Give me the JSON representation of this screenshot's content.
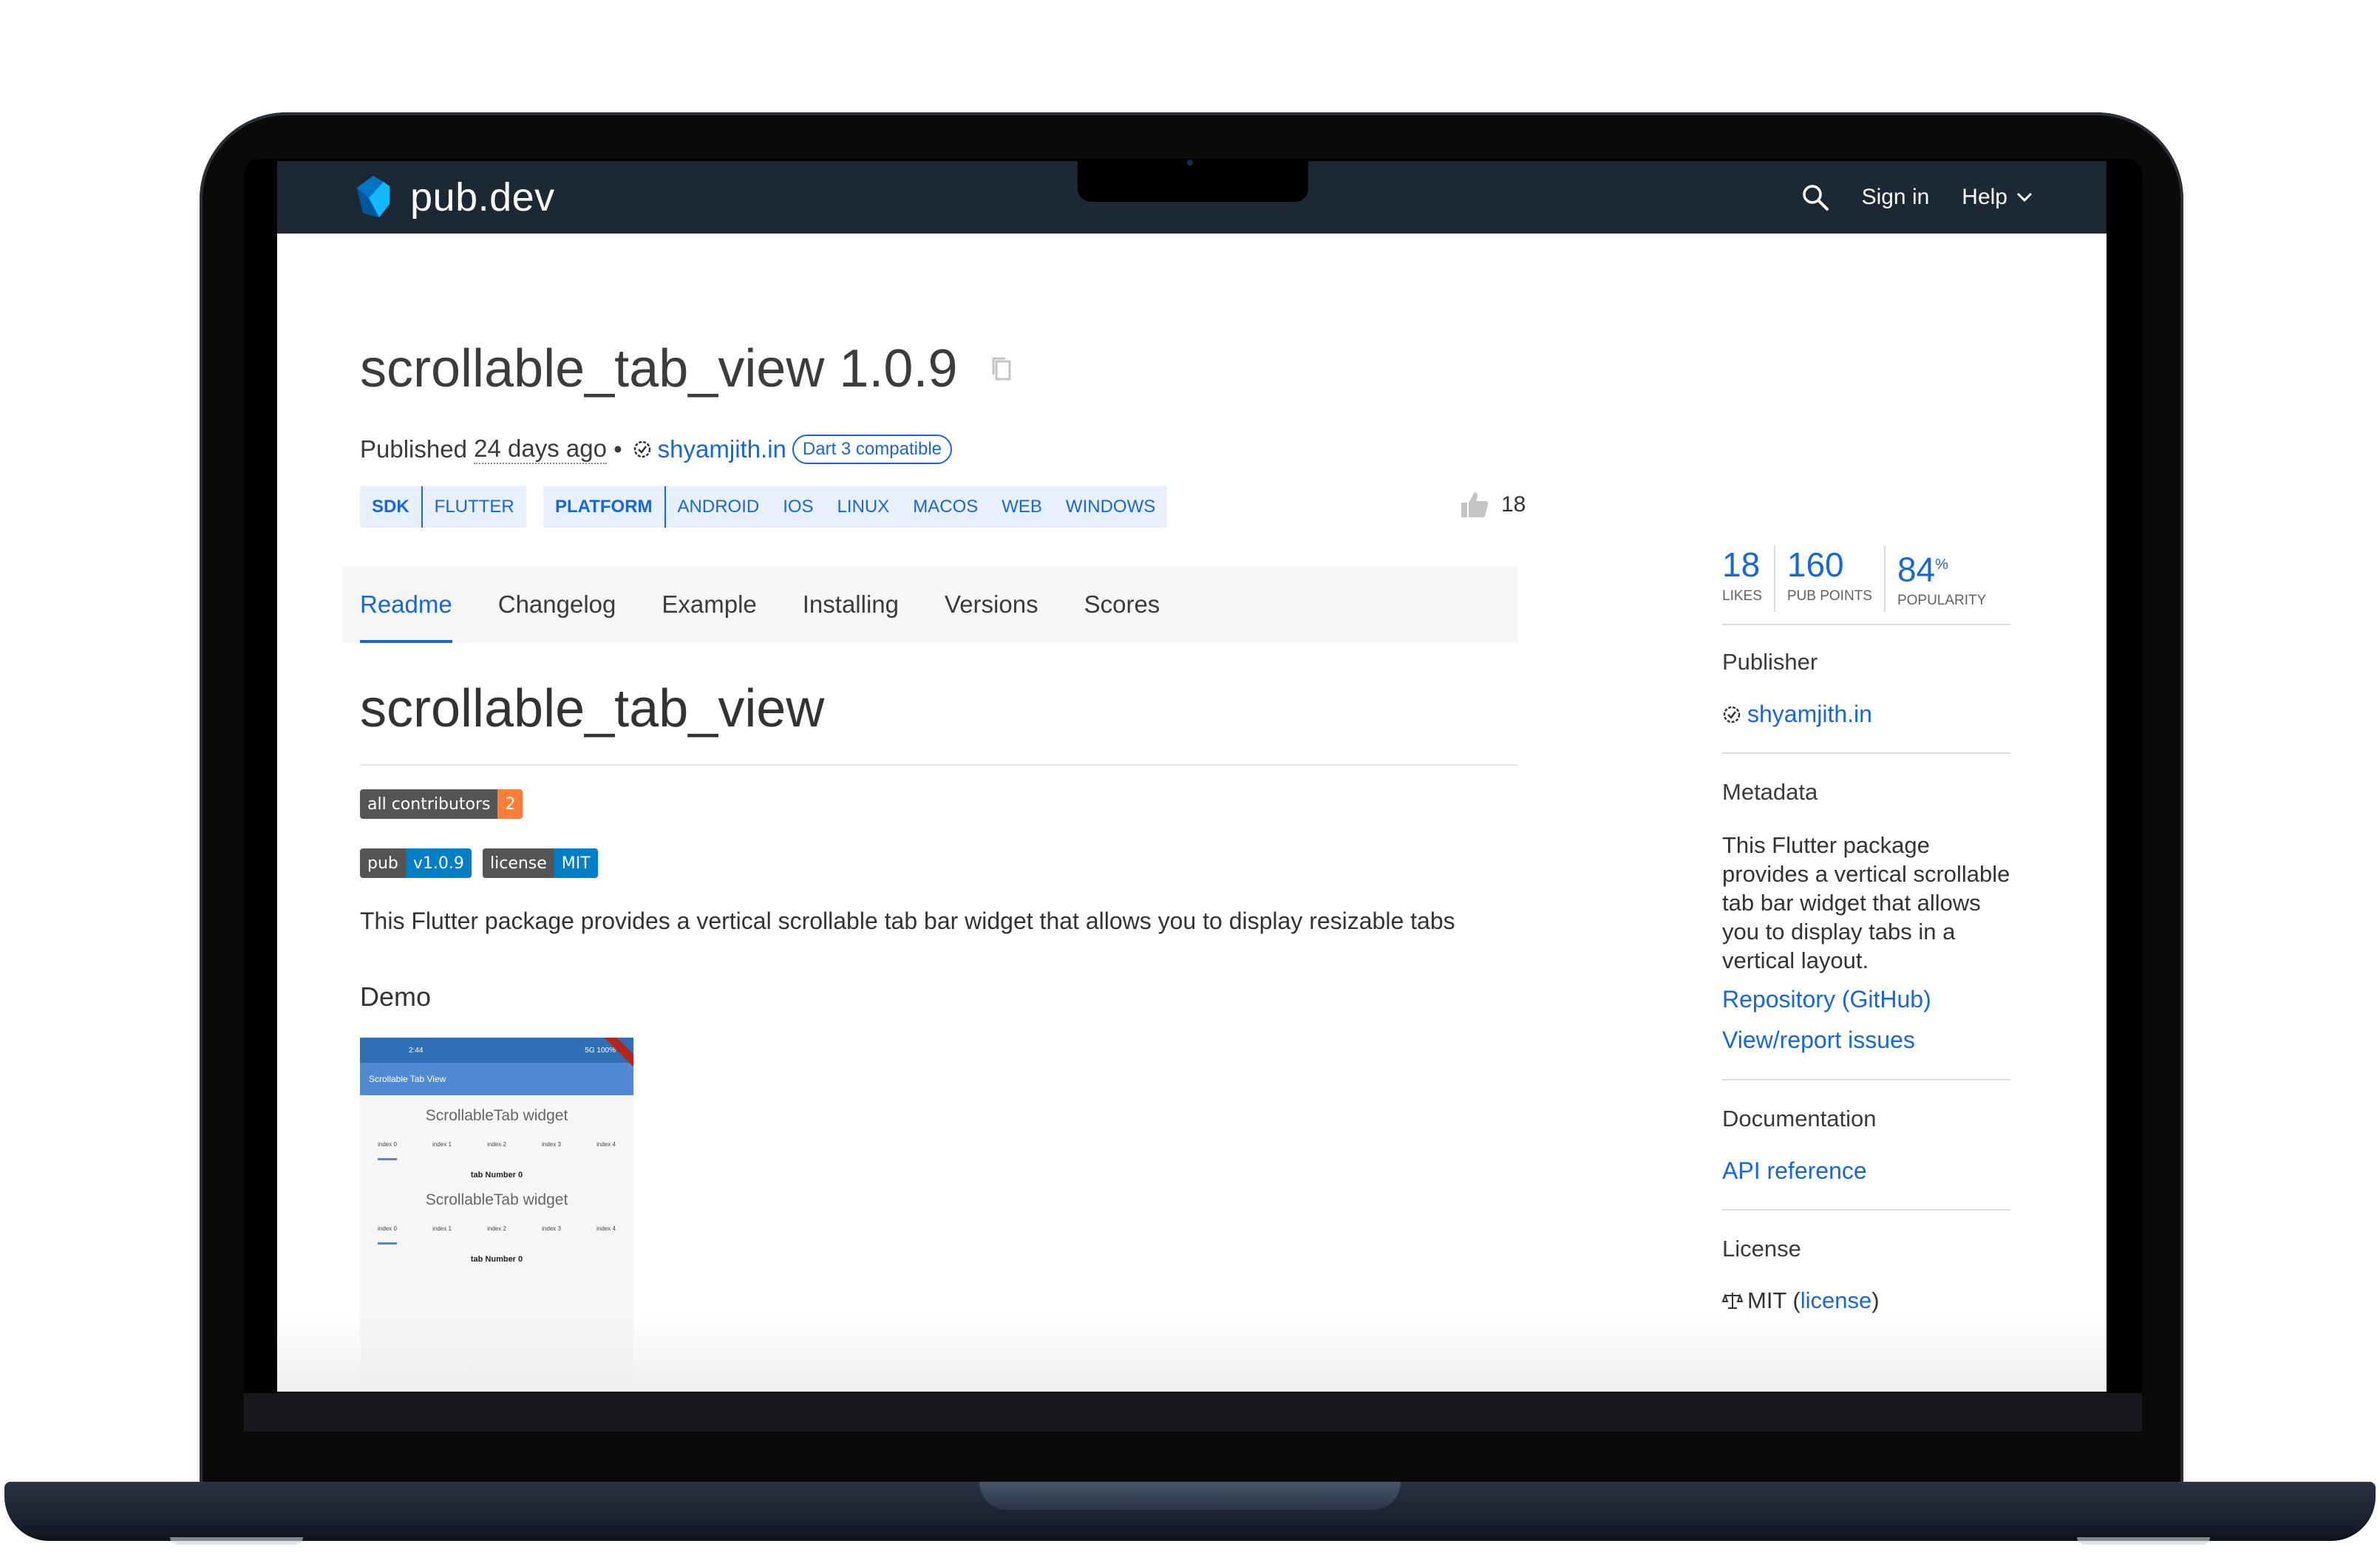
{
  "header": {
    "logo_text": "pub.dev",
    "sign_in": "Sign in",
    "help": "Help"
  },
  "package": {
    "title": "scrollable_tab_view 1.0.9",
    "published_prefix": "Published",
    "published_ago": "24 days ago",
    "separator": "•",
    "publisher": "shyamjith.in",
    "dart3_badge": "Dart 3 compatible",
    "likes_count": "18"
  },
  "tags": {
    "sdk_head": "SDK",
    "sdk": [
      "FLUTTER"
    ],
    "platform_head": "PLATFORM",
    "platforms": [
      "ANDROID",
      "IOS",
      "LINUX",
      "MACOS",
      "WEB",
      "WINDOWS"
    ]
  },
  "tabs": [
    "Readme",
    "Changelog",
    "Example",
    "Installing",
    "Versions",
    "Scores"
  ],
  "readme": {
    "heading": "scrollable_tab_view",
    "shield_contributors_label": "all contributors",
    "shield_contributors_value": "2",
    "shield_pub_label": "pub",
    "shield_pub_value": "v1.0.9",
    "shield_license_label": "license",
    "shield_license_value": "MIT",
    "description": "This Flutter package provides a vertical scrollable tab bar widget that allows you to display resizable tabs",
    "demo_heading": "Demo"
  },
  "demo": {
    "status_time": "2:44",
    "status_right": "5G 100%",
    "app_title": "Scrollable Tab View",
    "widget_title": "ScrollableTab widget",
    "tab_labels": [
      "index 0",
      "index 1",
      "index 2",
      "index 3",
      "index 4"
    ],
    "tab_content": "tab Number 0"
  },
  "sidebar": {
    "likes_value": "18",
    "likes_label": "LIKES",
    "points_value": "160",
    "points_label": "PUB POINTS",
    "popularity_value": "84",
    "popularity_unit": "%",
    "popularity_label": "POPULARITY",
    "publisher_heading": "Publisher",
    "publisher": "shyamjith.in",
    "metadata_heading": "Metadata",
    "metadata_text": "This Flutter package provides a vertical scrollable tab bar widget that allows you to display tabs in a vertical layout.",
    "repository_link": "Repository (GitHub)",
    "issues_link": "View/report issues",
    "documentation_heading": "Documentation",
    "api_link": "API reference",
    "license_heading": "License",
    "license_prefix": "MIT (",
    "license_link": "license",
    "license_suffix": ")"
  },
  "colors": {
    "nav_bg": "#1c2834",
    "link": "#1967d2",
    "tag_bg": "#e8f0fe",
    "shield_dark": "#555555",
    "shield_orange": "#fe7d37",
    "shield_blue": "#007ec6"
  }
}
